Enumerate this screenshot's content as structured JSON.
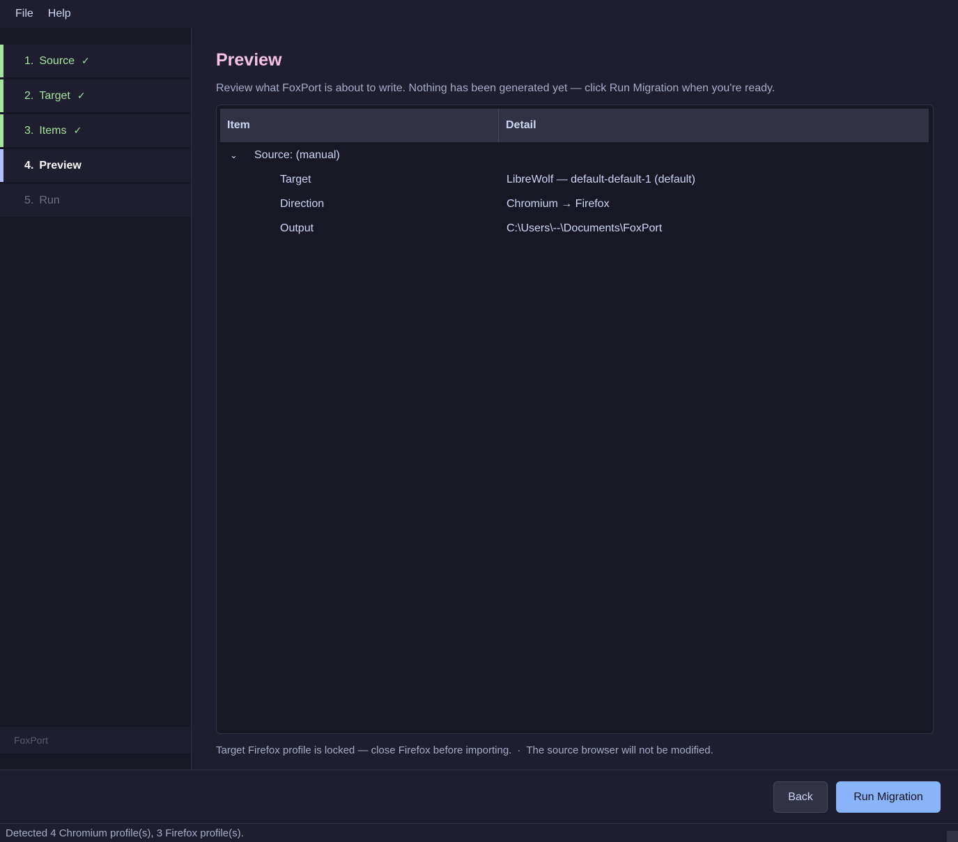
{
  "menu": {
    "file": "File",
    "help": "Help"
  },
  "sidebar": {
    "steps": [
      {
        "num": "1.",
        "label": "Source",
        "state": "done"
      },
      {
        "num": "2.",
        "label": "Target",
        "state": "done"
      },
      {
        "num": "3.",
        "label": "Items",
        "state": "done"
      },
      {
        "num": "4.",
        "label": "Preview",
        "state": "active"
      },
      {
        "num": "5.",
        "label": "Run",
        "state": "pending"
      }
    ],
    "check_glyph": "✓",
    "footer": "FoxPort"
  },
  "main": {
    "title": "Preview",
    "subtitle": "Review what FoxPort is about to write. Nothing has been generated yet — click Run Migration when you're ready.",
    "table": {
      "columns": {
        "item": "Item",
        "detail": "Detail"
      },
      "group": {
        "label": "Source: (manual)",
        "expanded": true,
        "chevron": "⌄"
      },
      "rows": [
        {
          "item": "Target",
          "detail": "LibreWolf — default-default-1 (default)"
        },
        {
          "item": "Direction",
          "detail": "Chromium → Firefox"
        },
        {
          "item": "Output",
          "detail": "C:\\Users\\--\\Documents\\FoxPort"
        }
      ]
    },
    "note": {
      "warning": "Target Firefox profile is locked — close Firefox before importing.",
      "separator": "·",
      "info": "The source browser will not be modified."
    }
  },
  "buttons": {
    "back": "Back",
    "run": "Run Migration"
  },
  "statusbar": "Detected 4 Chromium profile(s), 3 Firefox profile(s).",
  "colors": {
    "accent_done": "#a6e3a1",
    "accent_active": "#b4befe",
    "title": "#f5c2e7",
    "primary_button": "#89b4fa"
  }
}
